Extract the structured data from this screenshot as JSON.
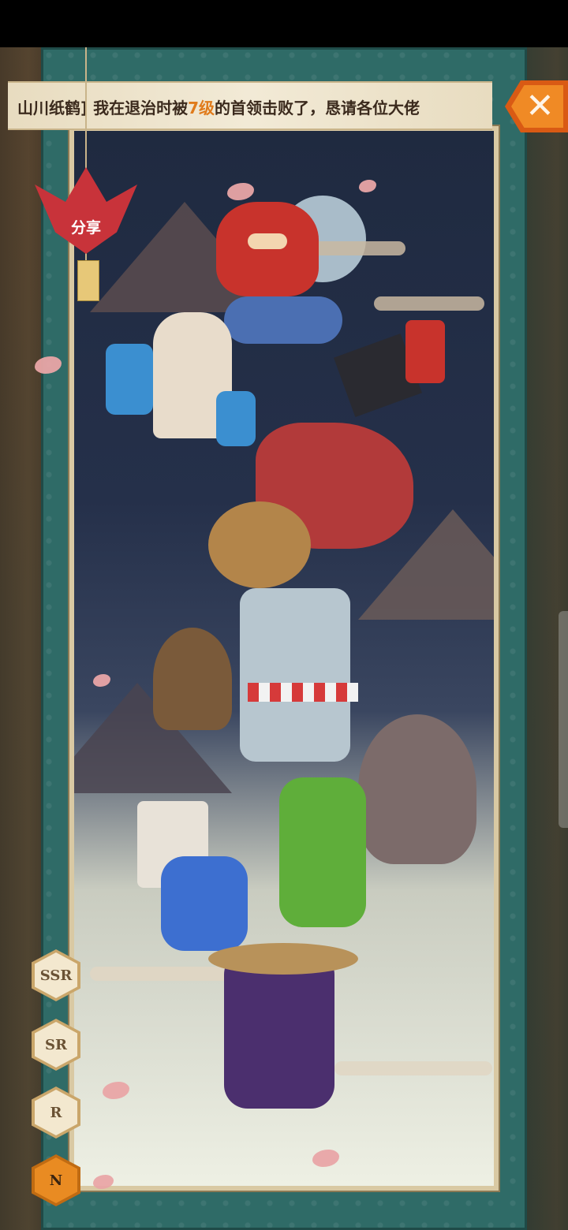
{
  "banner": {
    "prefix": "山川纸鹤] 我在退治时被",
    "level": "7级",
    "suffix": "的首领击败了，恳请各位大佬"
  },
  "share": {
    "label": "分享"
  },
  "close": {
    "symbol": "✕"
  },
  "rarity_tabs": [
    {
      "label": "SSR",
      "active": false
    },
    {
      "label": "SR",
      "active": false
    },
    {
      "label": "R",
      "active": false
    },
    {
      "label": "N",
      "active": true
    }
  ],
  "colors": {
    "accent": "#f08a25",
    "frame": "#2f6b67",
    "highlight": "#e07b1b"
  }
}
